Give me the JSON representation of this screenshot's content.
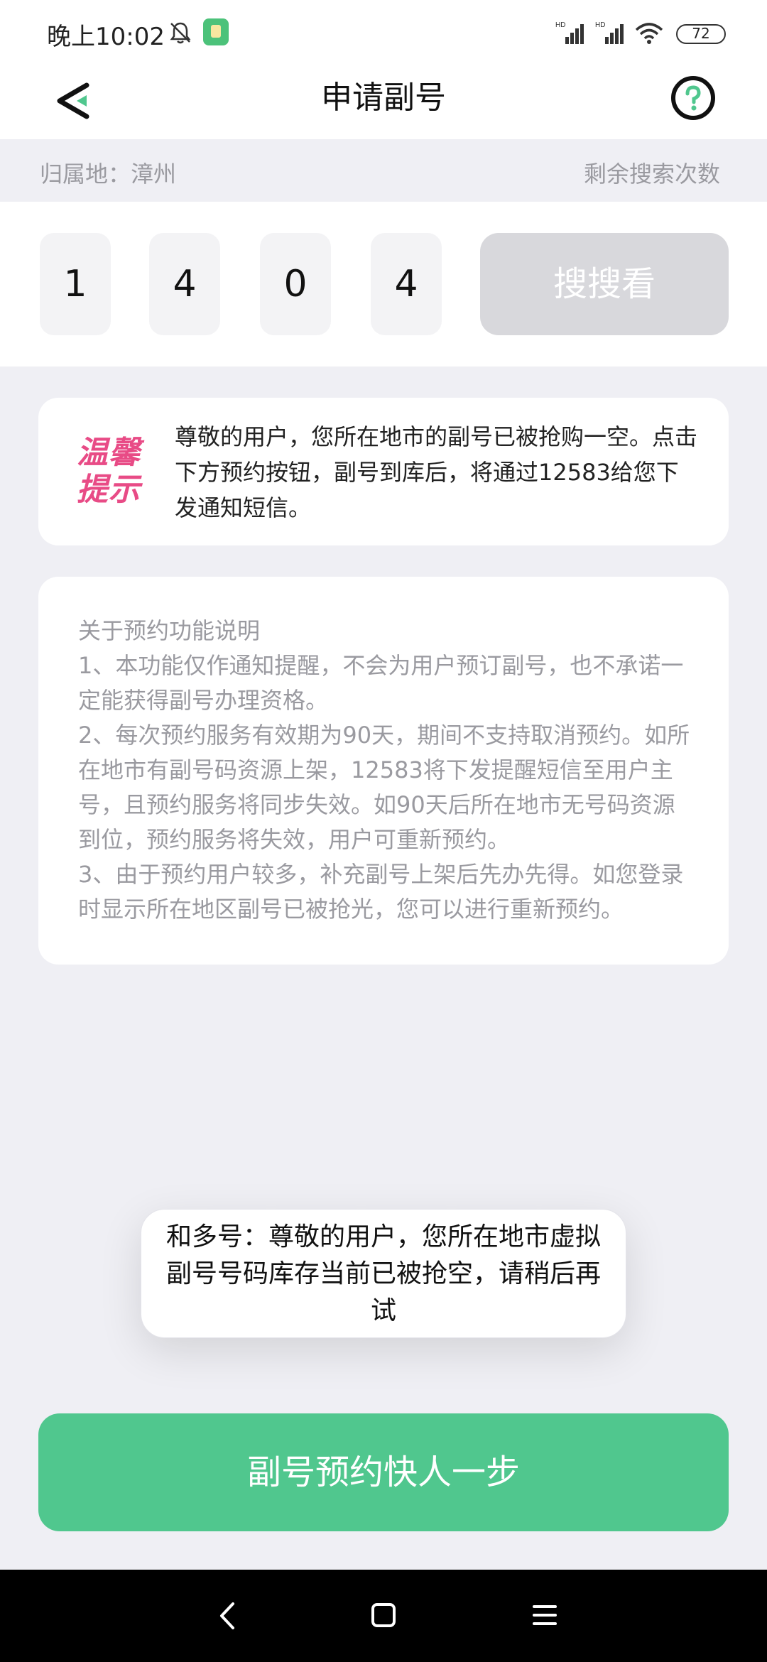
{
  "status_bar": {
    "time": "晚上10:02",
    "battery": "72",
    "icons": [
      "bell-muted-icon",
      "app-notification-icon",
      "hd-signal-icon",
      "hd-signal-icon",
      "wifi-icon",
      "battery-icon"
    ]
  },
  "nav": {
    "title": "申请副号",
    "back_icon": "back-arrow-icon",
    "help_icon": "question-circle-icon"
  },
  "location": {
    "label": "归属地：漳州",
    "remaining_label": "剩余搜索次数"
  },
  "digits": [
    "1",
    "4",
    "0",
    "4"
  ],
  "search_button": "搜搜看",
  "tip": {
    "badge": "温馨提示",
    "text": "尊敬的用户，您所在地市的副号已被抢购一空。点击下方预约按钮，副号到库后，将通过12583给您下发通知短信。"
  },
  "info": {
    "heading": "关于预约功能说明",
    "items": [
      "1、本功能仅作通知提醒，不会为用户预订副号，也不承诺一定能获得副号办理资格。",
      "2、每次预约服务有效期为90天，期间不支持取消预约。如所在地市有副号码资源上架，12583将下发提醒短信至用户主号，且预约服务将同步失效。如90天后所在地市无号码资源到位，预约服务将失效，用户可重新预约。",
      "3、由于预约用户较多，补充副号上架后先办先得。如您登录时显示所在地区副号已被抢光，您可以进行重新预约。"
    ]
  },
  "toast": {
    "text": "和多号：尊敬的用户，您所在地市虚拟副号号码库存当前已被抢空，请稍后再试"
  },
  "reserve_button": "副号预约快人一步",
  "system_nav": {
    "icons": [
      "back-icon",
      "home-icon",
      "menu-icon"
    ]
  },
  "colors": {
    "accent": "#50c78e",
    "tip_badge": "#e84b86",
    "background": "#efeff4"
  }
}
